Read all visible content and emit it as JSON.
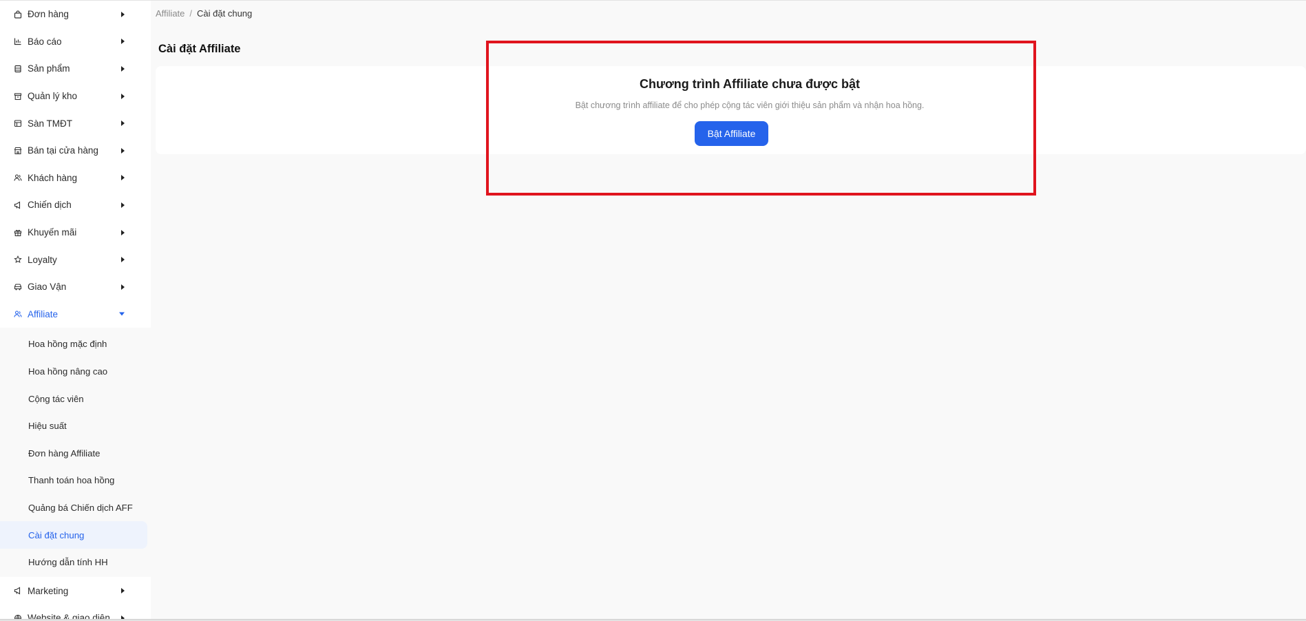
{
  "sidebar": {
    "items": [
      {
        "label": "Đơn hàng",
        "icon": "bag-icon"
      },
      {
        "label": "Báo cáo",
        "icon": "bar-chart-icon"
      },
      {
        "label": "Sản phẩm",
        "icon": "product-icon"
      },
      {
        "label": "Quản lý kho",
        "icon": "warehouse-icon"
      },
      {
        "label": "Sàn TMĐT",
        "icon": "store-icon"
      },
      {
        "label": "Bán tại cửa hàng",
        "icon": "shop-icon"
      },
      {
        "label": "Khách hàng",
        "icon": "users-icon"
      },
      {
        "label": "Chiến dịch",
        "icon": "megaphone-icon"
      },
      {
        "label": "Khuyến mãi",
        "icon": "gift-icon"
      },
      {
        "label": "Loyalty",
        "icon": "star-icon"
      },
      {
        "label": "Giao Vận",
        "icon": "truck-icon"
      }
    ],
    "affiliate": {
      "label": "Affiliate",
      "icon": "affiliate-users-icon",
      "expanded": true,
      "color": "#2563eb",
      "subitems": [
        {
          "label": "Hoa hồng mặc định"
        },
        {
          "label": "Hoa hồng nâng cao"
        },
        {
          "label": "Cộng tác viên"
        },
        {
          "label": "Hiệu suất"
        },
        {
          "label": "Đơn hàng Affiliate"
        },
        {
          "label": "Thanh toán hoa hồng"
        },
        {
          "label": "Quảng bá Chiến dịch AFF"
        },
        {
          "label": "Cài đặt chung",
          "selected": true
        },
        {
          "label": "Hướng dẫn tính HH"
        }
      ]
    },
    "after_items": [
      {
        "label": "Marketing",
        "icon": "megaphone-icon"
      },
      {
        "label": "Website & giao diện",
        "icon": "globe-icon"
      }
    ]
  },
  "breadcrumb": {
    "parent": "Affiliate",
    "separator": "/",
    "current": "Cài đặt chung"
  },
  "page": {
    "title": "Cài đặt Affiliate"
  },
  "card": {
    "title": "Chương trình Affiliate chưa được bật",
    "description": "Bật chương trình affiliate để cho phép cộng tác viên giới thiệu sản phẩm và nhận hoa hồng.",
    "button_label": "Bật Affiliate"
  },
  "colors": {
    "accent": "#2563eb",
    "highlight": "#e0141e"
  }
}
